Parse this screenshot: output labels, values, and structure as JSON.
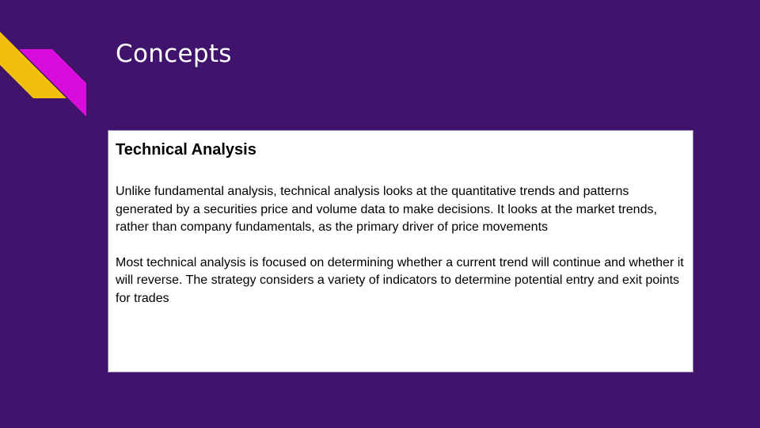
{
  "slide": {
    "title": "Concepts",
    "content": {
      "heading": "Technical Analysis",
      "paragraphs": [
        "Unlike fundamental analysis, technical analysis looks at the quantitative trends and patterns generated by a securities price and volume data to make decisions. It looks at the market trends, rather than company fundamentals, as the primary driver of price movements",
        "Most technical analysis is focused on determining whether a current trend will continue and whether it will reverse. The strategy considers a variety of indicators to determine potential entry and exit points for trades"
      ]
    }
  },
  "colors": {
    "background": "#40136c",
    "accent_yellow": "#f1bf0c",
    "accent_magenta": "#d80ddc",
    "title_text": "#ffffff",
    "box_background": "#ffffff"
  }
}
